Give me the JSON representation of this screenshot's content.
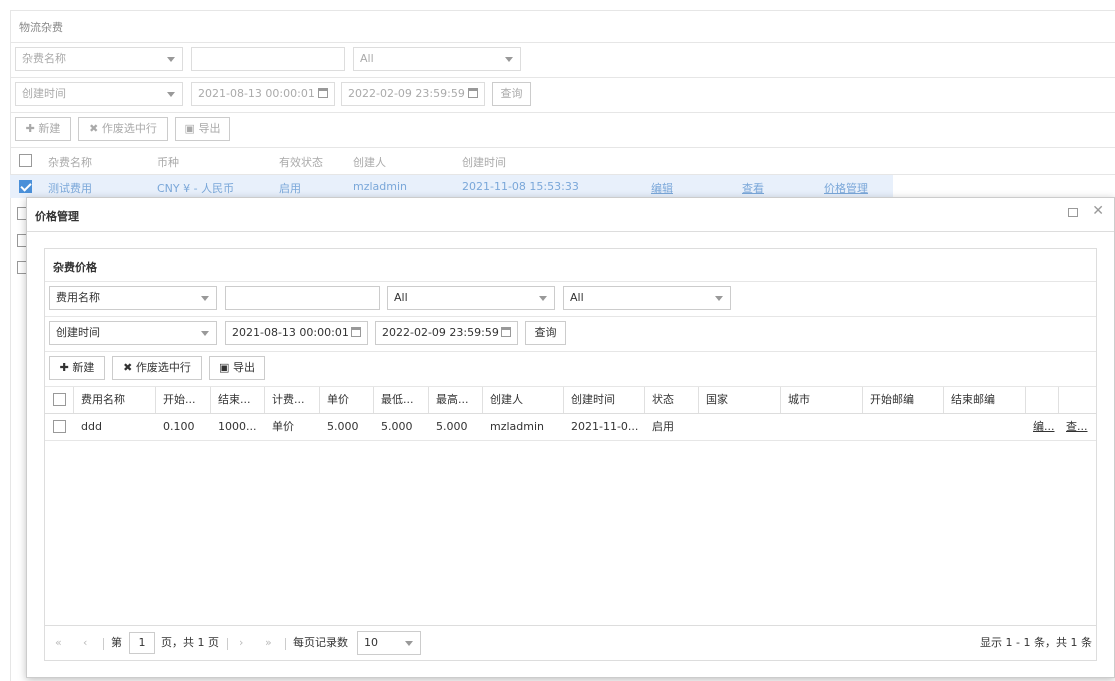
{
  "bg": {
    "title": "物流杂费",
    "filter1": {
      "field": "杂费名称",
      "value": "",
      "status": "All"
    },
    "filter2": {
      "field": "创建时间",
      "start": "2021-08-13 00:00:01",
      "end": "2022-02-09 23:59:59",
      "query": "查询"
    },
    "toolbar": {
      "new": "新建",
      "void": "作废选中行",
      "export": "导出"
    },
    "columns": [
      "杂费名称",
      "币种",
      "有效状态",
      "创建人",
      "创建时间"
    ],
    "row": {
      "name": "测试费用",
      "currency": "CNY ¥ - 人民币",
      "status": "启用",
      "creator": "mzladmin",
      "time": "2021-11-08 15:53:33",
      "edit": "编辑",
      "view": "查看",
      "price": "价格管理"
    }
  },
  "modal": {
    "title": "价格管理",
    "section": "杂费价格",
    "filter1": {
      "field": "费用名称",
      "value": "",
      "opt1": "All",
      "opt2": "All"
    },
    "filter2": {
      "field": "创建时间",
      "start": "2021-08-13 00:00:01",
      "end": "2022-02-09 23:59:59",
      "query": "查询"
    },
    "toolbar": {
      "new": "新建",
      "void": "作废选中行",
      "export": "导出"
    },
    "columns": [
      "费用名称",
      "开始...",
      "结束...",
      "计费...",
      "单价",
      "最低...",
      "最高...",
      "创建人",
      "创建时间",
      "状态",
      "国家",
      "城市",
      "开始邮编",
      "结束邮编",
      "",
      ""
    ],
    "rows": [
      [
        "ddd",
        "0.100",
        "1000...",
        "单价",
        "5.000",
        "5.000",
        "5.000",
        "mzladmin",
        "2021-11-0...",
        "启用",
        "",
        "",
        "",
        "",
        "编...",
        "查..."
      ]
    ],
    "pager": {
      "page_prefix": "第",
      "page": "1",
      "page_suffix": "页，共 1 页",
      "per_page_label": "每页记录数",
      "per_page": "10",
      "summary": "显示 1 - 1 条，共 1 条"
    }
  }
}
